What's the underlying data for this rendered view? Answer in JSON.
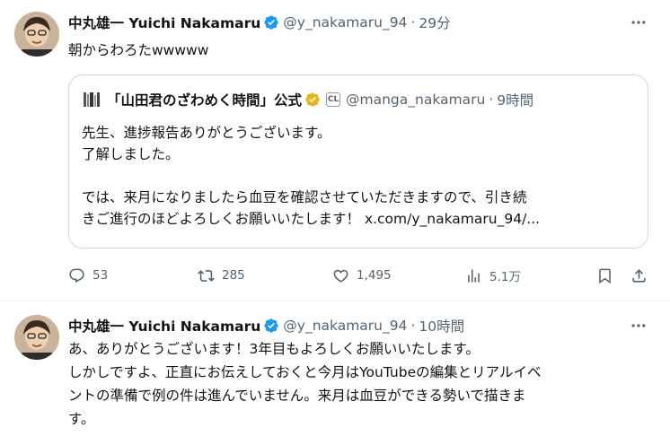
{
  "tweet1": {
    "name": "中丸雄一 Yuichi Nakamaru",
    "handle": "@y_nakamaru_94",
    "dot": "·",
    "time": "29分",
    "text": "朝からわろたwwwww",
    "quote": {
      "name": "「山田君のざわめく時間」公式",
      "affiliate_label": "CL",
      "handle": "@manga_nakamaru",
      "dot": "·",
      "time": "9時間",
      "line1": "先生、進捗報告ありがとうございます。",
      "line2": "了解しました。",
      "line3": "では、来月になりましたら血豆を確認させていただきますので、引き続",
      "line4_text": "きご進行のほどよろしくお願いいたします！ ",
      "line4_link": "x.com/y_nakamaru_94/..."
    },
    "actions": {
      "replies": "53",
      "retweets": "285",
      "likes": "1,495",
      "views": "5.1万"
    }
  },
  "tweet2": {
    "name": "中丸雄一 Yuichi Nakamaru",
    "handle": "@y_nakamaru_94",
    "dot": "·",
    "time": "10時間",
    "line1": "あ、ありがとうございます！3年目もよろしくお願いいたします。",
    "line2": "しかしですよ、正直にお伝えしておくと今月はYouTubeの編集とリアルイベ",
    "line3": "ントの準備で例の件は進んでいません。来月は血豆ができる勢いで描きま",
    "line4": "す。"
  },
  "colors": {
    "text": "#0f1419",
    "secondary": "#536471",
    "verified_blue": "#1d9bf0",
    "gold": "#e2b719",
    "border": "#cfd9de"
  }
}
